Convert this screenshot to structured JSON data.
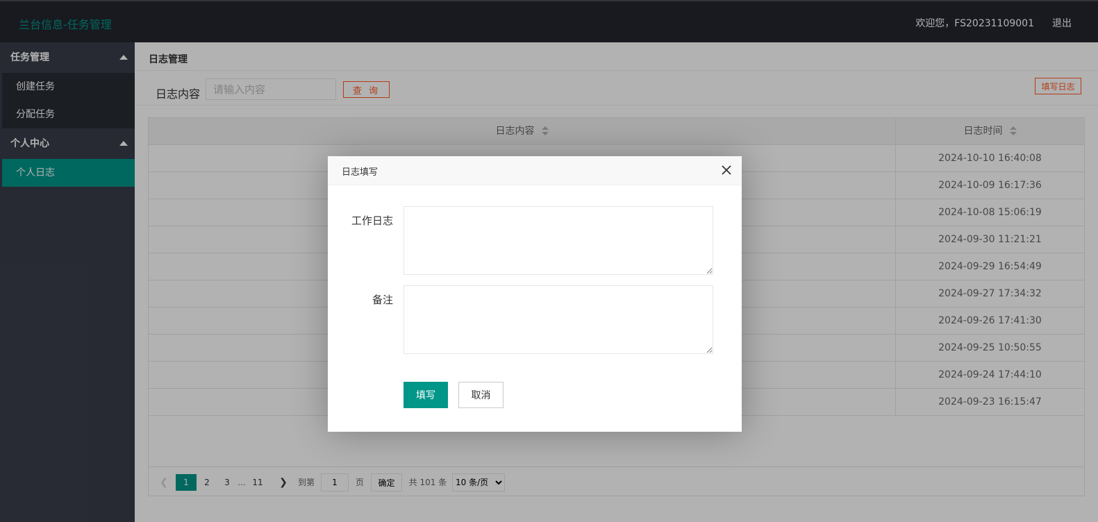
{
  "header": {
    "brand": "兰台信息-任务管理",
    "welcome": "欢迎您，FS20231109001",
    "logout": "退出"
  },
  "sidebar": {
    "groups": [
      {
        "label": "任务管理",
        "items": [
          {
            "label": "创建任务"
          },
          {
            "label": "分配任务"
          }
        ]
      },
      {
        "label": "个人中心",
        "items": [
          {
            "label": "个人日志",
            "active": true
          }
        ]
      }
    ]
  },
  "main": {
    "page_title": "日志管理",
    "search": {
      "label": "日志内容",
      "placeholder": "请输入内容",
      "query_button": "查 询"
    },
    "write_log_button": "填写日志",
    "table": {
      "columns": [
        "日志内容",
        "日志时间"
      ],
      "rows": [
        {
          "content": "",
          "time": "2024-10-10 16:40:08"
        },
        {
          "content": "",
          "time": "2024-10-09 16:17:36"
        },
        {
          "content": "",
          "time": "2024-10-08 15:06:19"
        },
        {
          "content": "",
          "time": "2024-09-30 11:21:21"
        },
        {
          "content": "",
          "time": "2024-09-29 16:54:49"
        },
        {
          "content": "",
          "time": "2024-09-27 17:34:32"
        },
        {
          "content": "",
          "time": "2024-09-26 17:41:30"
        },
        {
          "content": "",
          "time": "2024-09-25 10:50:55"
        },
        {
          "content": "",
          "time": "2024-09-24 17:44:10"
        },
        {
          "content": "",
          "time": "2024-09-23 16:15:47"
        }
      ]
    },
    "pager": {
      "current": "1",
      "pages": [
        "2",
        "3"
      ],
      "ellipsis": "…",
      "last": "11",
      "goto_label": "到第",
      "goto_value": "1",
      "page_suffix": "页",
      "confirm": "确定",
      "total": "共 101 条",
      "page_size": "10 条/页"
    }
  },
  "dialog": {
    "title": "日志填写",
    "fields": [
      {
        "label": "工作日志",
        "value": ""
      },
      {
        "label": "备注",
        "value": ""
      }
    ],
    "submit": "填写",
    "cancel": "取消"
  },
  "colors": {
    "accent": "#009688",
    "danger": "#ff5722",
    "header_bg": "#23262e",
    "sidebar_bg": "#393d49"
  }
}
